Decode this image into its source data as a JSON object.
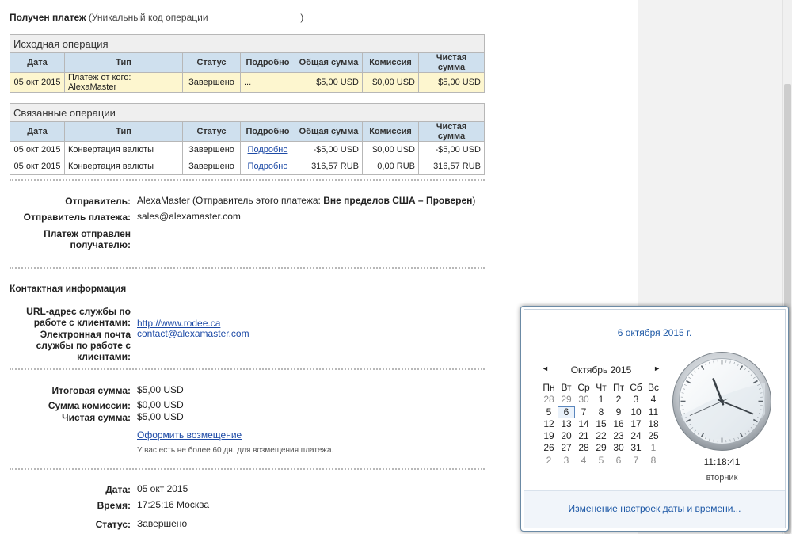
{
  "header": {
    "title": "Получен платеж",
    "subtitle_prefix": "(Уникальный код операции",
    "subtitle_suffix": ")"
  },
  "original_table": {
    "caption": "Исходная операция",
    "columns": [
      "Дата",
      "Тип",
      "Статус",
      "Подробно",
      "Общая сумма",
      "Комиссия",
      "Чистая сумма"
    ],
    "rows": [
      [
        "05 окт 2015",
        "Платеж от кого: AlexaMaster",
        "Завершено",
        "...",
        "$5,00 USD",
        "$0,00 USD",
        "$5,00 USD"
      ]
    ]
  },
  "related_table": {
    "caption": "Связанные операции",
    "columns": [
      "Дата",
      "Тип",
      "Статус",
      "Подробно",
      "Общая сумма",
      "Комиссия",
      "Чистая сумма"
    ],
    "rows": [
      [
        "05 окт 2015",
        "Конвертация валюты",
        "Завершено",
        "Подробно",
        "-$5,00 USD",
        "$0,00 USD",
        "-$5,00 USD"
      ],
      [
        "05 окт 2015",
        "Конвертация валюты",
        "Завершено",
        "Подробно",
        "316,57 RUB",
        "0,00 RUB",
        "316,57 RUB"
      ]
    ]
  },
  "sender": {
    "sender_label": "Отправитель:",
    "sender_name": "AlexaMaster",
    "sender_note_prefix": "(Отправитель этого платежа:",
    "sender_note_bold": "Вне пределов США – Проверен",
    "sender_note_suffix": ")",
    "payment_sender_label": "Отправитель платежа:",
    "payment_sender_email": "sales@alexamaster.com",
    "sent_to_label_line1": "Платеж отправлен",
    "sent_to_label_line2": "получателю:"
  },
  "contact": {
    "section_title": "Контактная информация",
    "url_label_line1": "URL-адрес службы по",
    "url_label_line2": "работе с клиентами:",
    "url_value": "http://www.rodee.ca",
    "email_label_line1": "Электронная почта",
    "email_label_line2": "службы по работе с",
    "email_label_line3": "клиентами:",
    "email_value": "contact@alexamaster.com"
  },
  "totals": {
    "total_label": "Итоговая сумма:",
    "total_value": "$5,00 USD",
    "fee_label": "Сумма комиссии:",
    "fee_value": "$0,00 USD",
    "net_label": "Чистая сумма:",
    "net_value": "$5,00 USD",
    "refund_link": "Оформить возмещение",
    "refund_note": "У вас есть не более 60 дн. для возмещения платежа."
  },
  "details": {
    "date_label": "Дата:",
    "date_value": "05 окт 2015",
    "time_label": "Время:",
    "time_value": "17:25:16 Москва",
    "status_label": "Статус:",
    "status_value": "Завершено"
  },
  "clock_popup": {
    "full_date": "6 октября 2015 г.",
    "month_label": "Октябрь 2015",
    "prev_glyph": "◄",
    "next_glyph": "►",
    "weekdays": [
      "Пн",
      "Вт",
      "Ср",
      "Чт",
      "Пт",
      "Сб",
      "Вс"
    ],
    "weeks": [
      [
        "28",
        "29",
        "30",
        "1",
        "2",
        "3",
        "4"
      ],
      [
        "5",
        "6",
        "7",
        "8",
        "9",
        "10",
        "11"
      ],
      [
        "12",
        "13",
        "14",
        "15",
        "16",
        "17",
        "18"
      ],
      [
        "19",
        "20",
        "21",
        "22",
        "23",
        "24",
        "25"
      ],
      [
        "26",
        "27",
        "28",
        "29",
        "30",
        "31",
        "1"
      ],
      [
        "2",
        "3",
        "4",
        "5",
        "6",
        "7",
        "8"
      ]
    ],
    "today": "6",
    "time": "11:18:41",
    "weekday": "вторник",
    "clock_hour": 11,
    "clock_minute": 18,
    "clock_second": 41,
    "footer_link": "Изменение настроек даты и времени..."
  }
}
